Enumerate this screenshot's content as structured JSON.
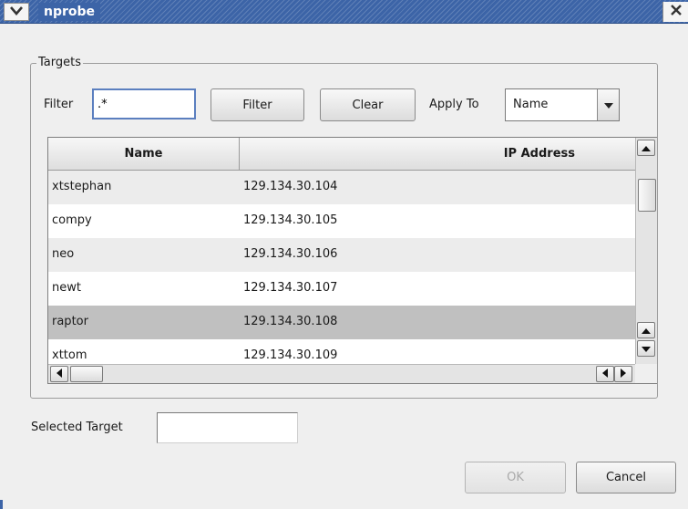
{
  "window": {
    "title": "nprobe",
    "colors": {
      "titlebar": "#3c64a7",
      "selected_row": "#c0c0c0",
      "alt_row": "#ececec"
    },
    "icons": {
      "menu": "chevron-down-icon",
      "close": "close-icon"
    }
  },
  "targets": {
    "legend": "Targets",
    "filter_label": "Filter",
    "filter_value": ".*",
    "filter_button": "Filter",
    "clear_button": "Clear",
    "apply_to_label": "Apply To",
    "apply_to_value": "Name",
    "table": {
      "columns": [
        "Name",
        "IP Address"
      ],
      "rows": [
        {
          "name": "xtstephan",
          "ip": "129.134.30.104"
        },
        {
          "name": "compy",
          "ip": "129.134.30.105"
        },
        {
          "name": "neo",
          "ip": "129.134.30.106"
        },
        {
          "name": "newt",
          "ip": "129.134.30.107"
        },
        {
          "name": "raptor",
          "ip": "129.134.30.108"
        },
        {
          "name": "xttom",
          "ip": "129.134.30.109"
        }
      ],
      "selected_row": 4
    }
  },
  "selected_target": {
    "label": "Selected Target",
    "value": ""
  },
  "buttons": {
    "ok": "OK",
    "cancel": "Cancel"
  }
}
